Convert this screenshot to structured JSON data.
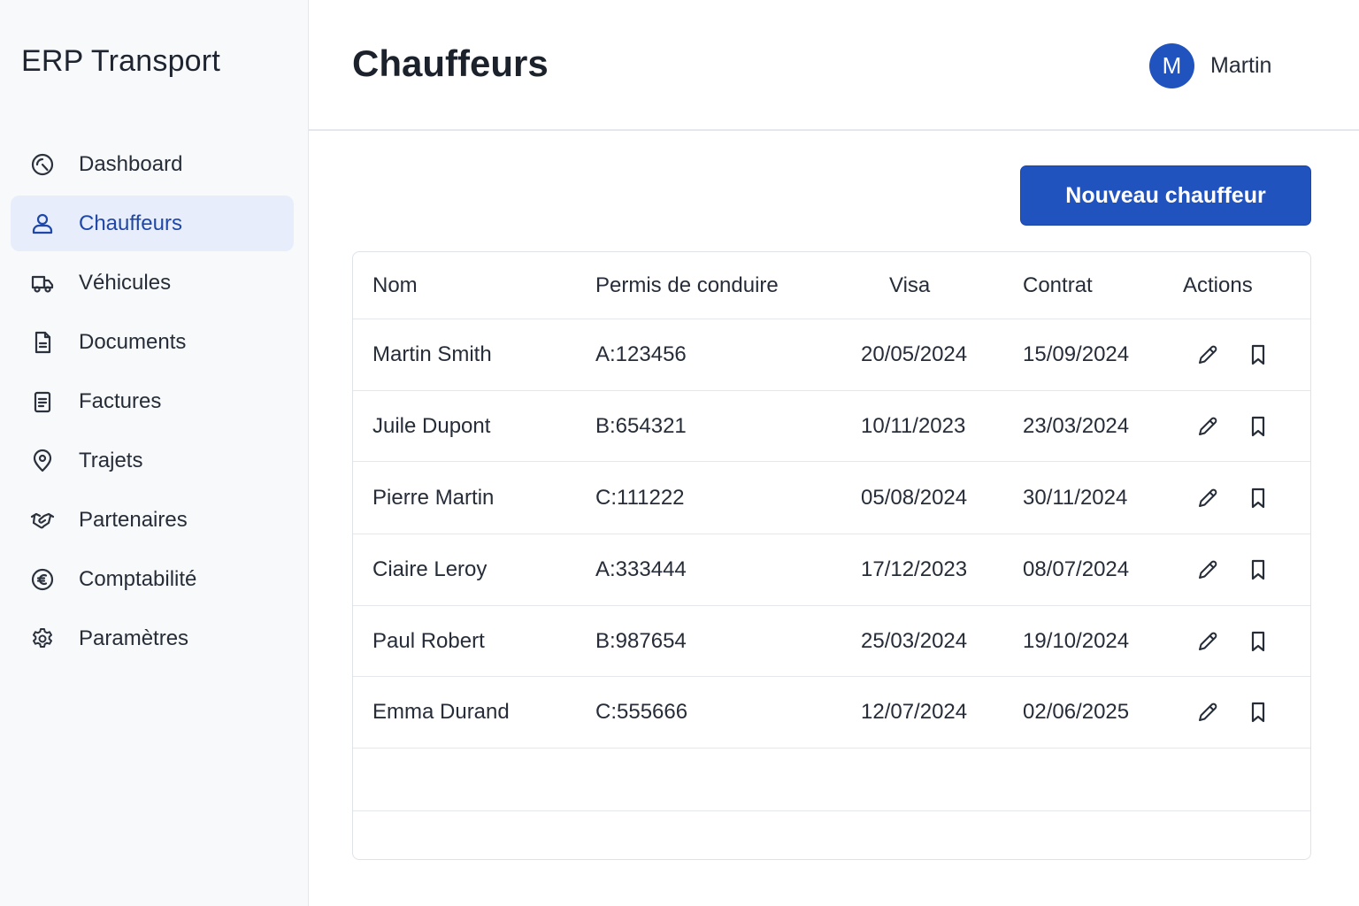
{
  "app": {
    "brand": "ERP Transport"
  },
  "sidebar": {
    "items": [
      {
        "label": "Dashboard",
        "icon": "dashboard-icon",
        "active": false
      },
      {
        "label": "Chauffeurs",
        "icon": "user-icon",
        "active": true
      },
      {
        "label": "Véhicules",
        "icon": "truck-icon",
        "active": false
      },
      {
        "label": "Documents",
        "icon": "document-icon",
        "active": false
      },
      {
        "label": "Factures",
        "icon": "invoice-icon",
        "active": false
      },
      {
        "label": "Trajets",
        "icon": "map-pin-icon",
        "active": false
      },
      {
        "label": "Partenaires",
        "icon": "handshake-icon",
        "active": false
      },
      {
        "label": "Comptabilité",
        "icon": "euro-icon",
        "active": false
      },
      {
        "label": "Paramètres",
        "icon": "gear-icon",
        "active": false
      }
    ]
  },
  "header": {
    "title": "Chauffeurs",
    "user": {
      "initial": "M",
      "name": "Martin"
    }
  },
  "toolbar": {
    "new_driver_label": "Nouveau chauffeur"
  },
  "table": {
    "columns": {
      "nom": "Nom",
      "permis": "Permis de conduire",
      "visa": "Visa",
      "contrat": "Contrat",
      "actions": "Actions"
    },
    "rows": [
      {
        "nom": "Martin Smith",
        "permis": "A:123456",
        "visa": "20/05/2024",
        "contrat": "15/09/2024"
      },
      {
        "nom": "Juile Dupont",
        "permis": "B:654321",
        "visa": "10/11/2023",
        "contrat": "23/03/2024"
      },
      {
        "nom": "Pierre Martin",
        "permis": "C:111222",
        "visa": "05/08/2024",
        "contrat": "30/11/2024"
      },
      {
        "nom": "Ciaire Leroy",
        "permis": "A:333444",
        "visa": "17/12/2023",
        "contrat": "08/07/2024"
      },
      {
        "nom": "Paul Robert",
        "permis": "B:987654",
        "visa": "25/03/2024",
        "contrat": "19/10/2024"
      },
      {
        "nom": "Emma Durand",
        "permis": "C:555666",
        "visa": "12/07/2024",
        "contrat": "02/06/2025"
      }
    ],
    "row_actions": [
      "edit-icon",
      "bookmark-icon"
    ]
  },
  "colors": {
    "accent": "#2153bf",
    "active_nav_bg": "#e7edfa",
    "active_nav_text": "#1f47a8",
    "sidebar_bg": "#f8f9fa",
    "border": "#e4e7eb"
  }
}
